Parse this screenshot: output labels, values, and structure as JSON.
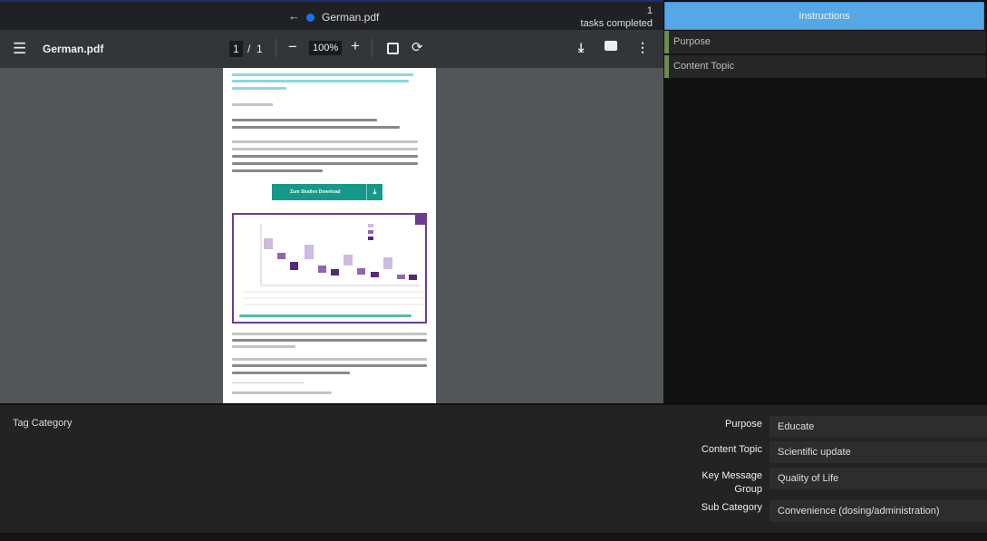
{
  "tab": {
    "title": "German.pdf",
    "back_icon": "arrow-left-icon",
    "status_color": "#1a73e8"
  },
  "tasks": {
    "count": "1",
    "label": "tasks completed"
  },
  "pdf_toolbar": {
    "file_name": "German.pdf",
    "page_current": "1",
    "page_sep": "/",
    "page_total": "1",
    "zoom": "100%"
  },
  "pdf_page": {
    "button_label": "Zum Studien Download"
  },
  "right_panel": {
    "instructions_label": "Instructions",
    "items": [
      {
        "label": "Purpose"
      },
      {
        "label": "Content Topic"
      }
    ],
    "accent": "#56a7e6",
    "item_marker": "#6b8e4e"
  },
  "bottom_panel": {
    "title": "Tag Category",
    "fields": [
      {
        "label": "Purpose",
        "value": "Educate"
      },
      {
        "label": "Content Topic",
        "value": "Scientific update"
      },
      {
        "label": "Key Message Group",
        "value": "Quality of Life"
      },
      {
        "label": "Sub Category",
        "value": "Convenience (dosing/administration)"
      }
    ]
  }
}
